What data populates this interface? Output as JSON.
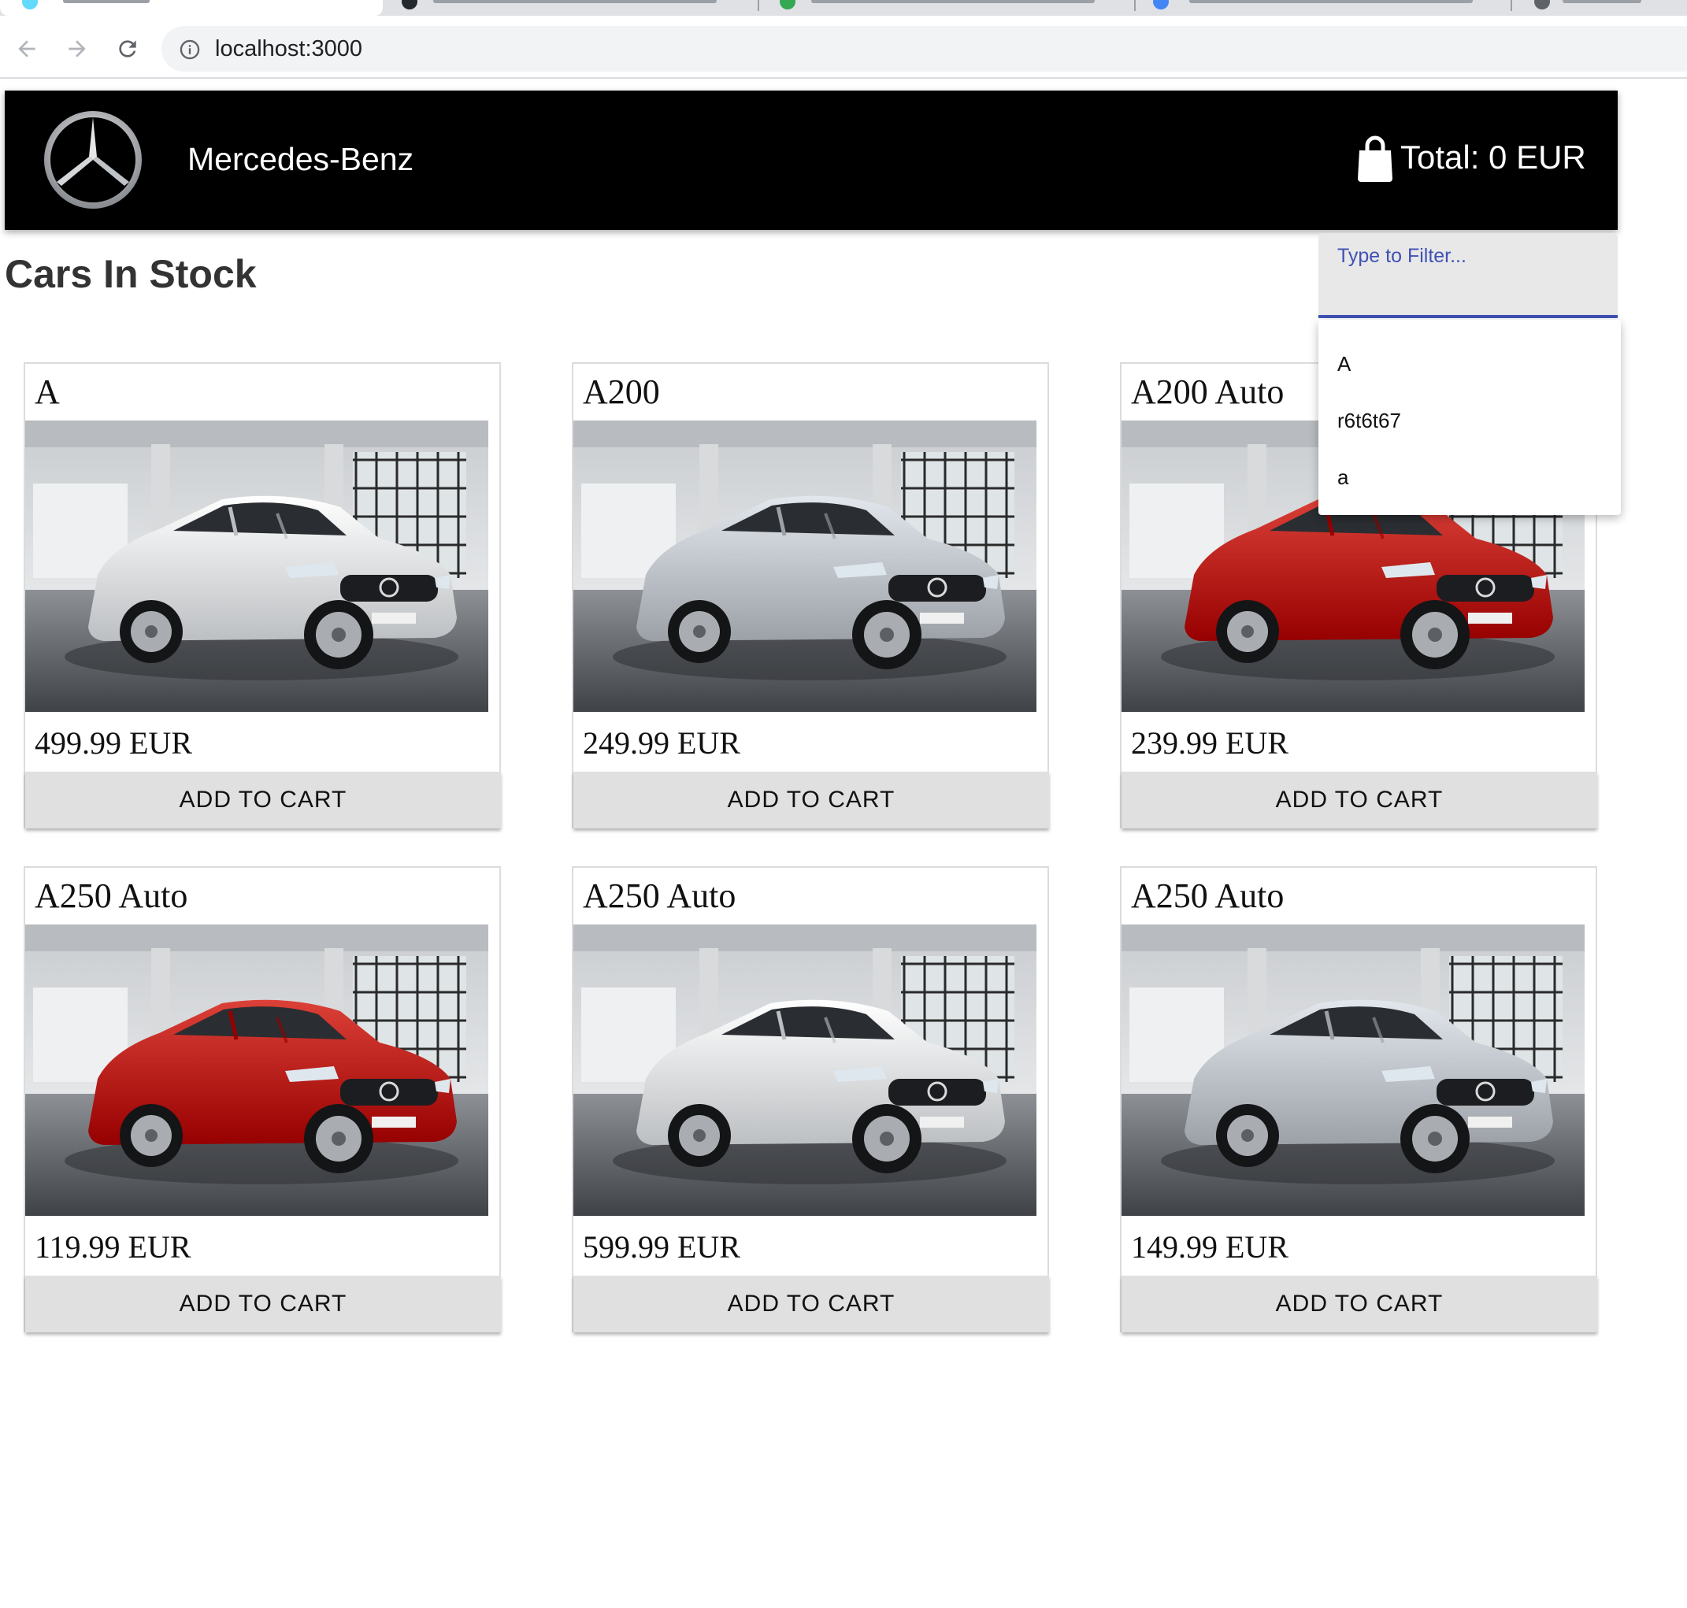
{
  "browser": {
    "url": "localhost:3000"
  },
  "header": {
    "brand": "Mercedes-Benz",
    "total": "Total: 0 EUR"
  },
  "page": {
    "title": "Cars In Stock"
  },
  "filter": {
    "label": "Type to Filter...",
    "value": "",
    "suggestions": [
      "A",
      "r6t6t67",
      "a"
    ]
  },
  "products": [
    {
      "name": "A",
      "price": "499.99 EUR",
      "button": "ADD TO CART",
      "color": "white"
    },
    {
      "name": "A200",
      "price": "249.99 EUR",
      "button": "ADD TO CART",
      "color": "silver"
    },
    {
      "name": "A200 Auto",
      "price": "239.99 EUR",
      "button": "ADD TO CART",
      "color": "red"
    },
    {
      "name": "A250 Auto",
      "price": "119.99 EUR",
      "button": "ADD TO CART",
      "color": "red"
    },
    {
      "name": "A250 Auto",
      "price": "599.99 EUR",
      "button": "ADD TO CART",
      "color": "white"
    },
    {
      "name": "A250 Auto",
      "price": "149.99 EUR",
      "button": "ADD TO CART",
      "color": "silver"
    }
  ],
  "colors": {
    "header_bg": "#000000",
    "accent": "#3f51b5",
    "button_bg": "#e0e0e0",
    "car_white": "#e9ecef",
    "car_silver": "#c9ced4",
    "car_red": "#c3281f"
  }
}
